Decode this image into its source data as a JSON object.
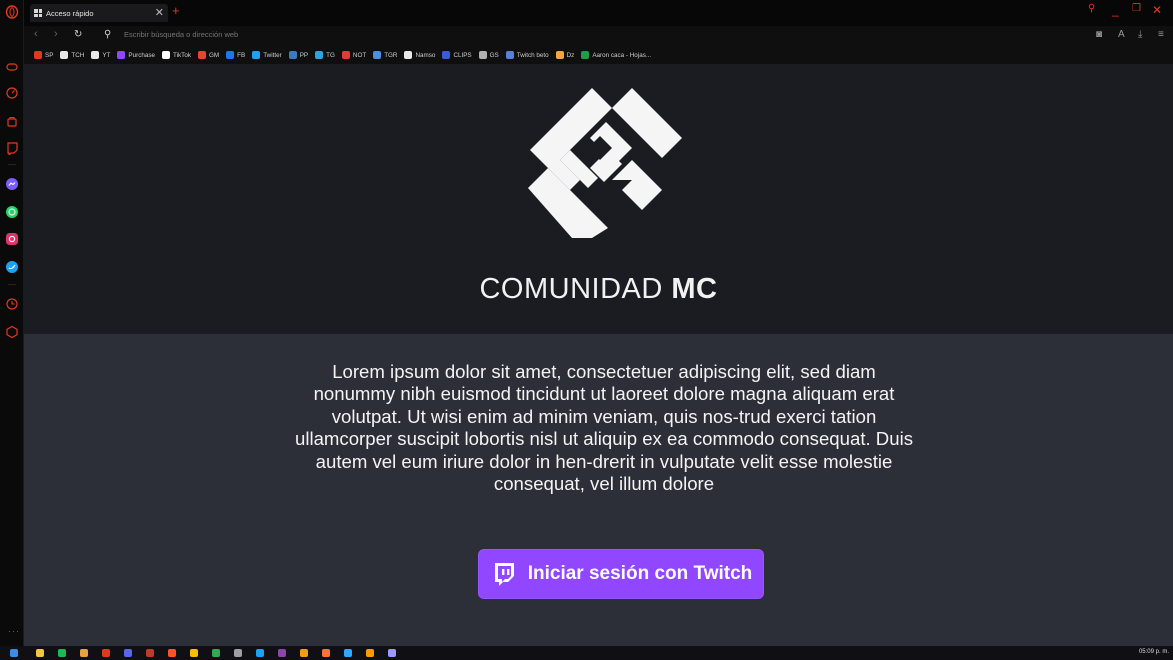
{
  "browser": {
    "tab": {
      "title": "Acceso rápido"
    },
    "address": {
      "placeholder": "Escribir búsqueda o dirección web"
    },
    "accent_color": "#e0391f",
    "bookmarks": [
      {
        "label": "SP",
        "color": "#e0391f"
      },
      {
        "label": "TCH",
        "color": "#e8e8e8"
      },
      {
        "label": "YT",
        "color": "#e8e8e8"
      },
      {
        "label": "Purchase",
        "color": "#9147ff"
      },
      {
        "label": "TikTok",
        "color": "#ffffff"
      },
      {
        "label": "GM",
        "color": "#ea4335"
      },
      {
        "label": "FB",
        "color": "#1877f2"
      },
      {
        "label": "Twitter",
        "color": "#1da1f2"
      },
      {
        "label": "PP",
        "color": "#3b7bbf"
      },
      {
        "label": "TG",
        "color": "#2aa3df"
      },
      {
        "label": "NOT",
        "color": "#e53935"
      },
      {
        "label": "TGR",
        "color": "#4a90e2"
      },
      {
        "label": "Namso",
        "color": "#e8e8e8"
      },
      {
        "label": "CLIPS",
        "color": "#3a5bd9"
      },
      {
        "label": "GS",
        "color": "#b0b0b0"
      },
      {
        "label": "Twitch beto",
        "color": "#5a7fd6"
      },
      {
        "label": "Dz",
        "color": "#f2a63b"
      },
      {
        "label": "Aaron caca - Hojas...",
        "color": "#1e9e4a"
      }
    ]
  },
  "page": {
    "brand_light": "COMUNIDAD",
    "brand_bold": "MC",
    "body_text": "Lorem ipsum dolor sit amet, consectetuer adipiscing elit, sed diam nonummy nibh euismod tincidunt ut laoreet dolore magna aliquam erat volutpat. Ut wisi enim ad minim veniam, quis nos-trud exerci tation ullamcorper suscipit lobortis nisl ut aliquip ex ea commodo consequat. Duis autem vel eum iriure dolor in hen-drerit in vulputate velit esse molestie consequat, vel illum dolore",
    "login_button": "Iniciar sesión con Twitch",
    "twitch_color": "#9147ff"
  },
  "taskbar": {
    "clock": "05:09 p. m."
  }
}
